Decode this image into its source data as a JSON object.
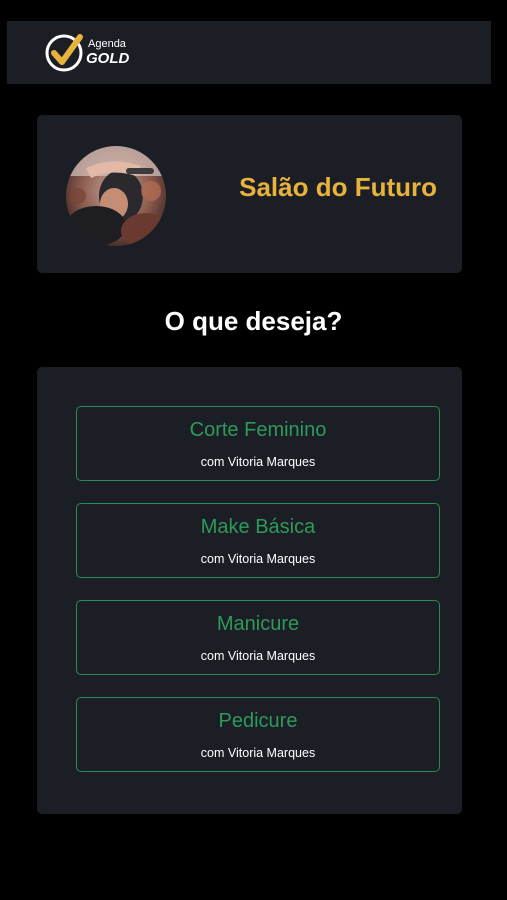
{
  "header": {
    "logo_top": "Agenda",
    "logo_bottom": "GOLD"
  },
  "salon": {
    "name": "Salão do Futuro"
  },
  "question": "O que deseja?",
  "services": [
    {
      "name": "Corte Feminino",
      "professional": "com Vitoria Marques"
    },
    {
      "name": "Make Básica",
      "professional": "com Vitoria Marques"
    },
    {
      "name": "Manicure",
      "professional": "com Vitoria Marques"
    },
    {
      "name": "Pedicure",
      "professional": "com Vitoria Marques"
    }
  ],
  "colors": {
    "background": "#000000",
    "card": "#1b1e25",
    "gold": "#e7b33c",
    "service_green": "#2e9a5a",
    "text_white": "#ffffff"
  }
}
